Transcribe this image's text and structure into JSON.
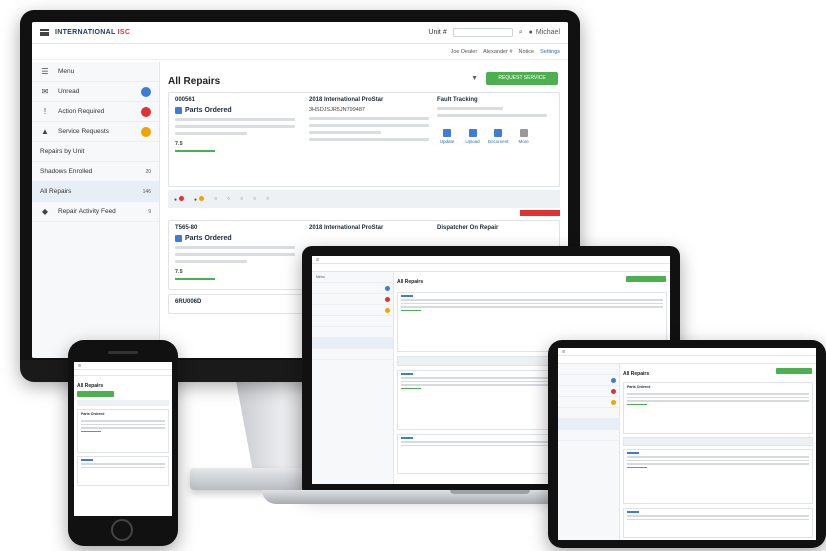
{
  "app": {
    "brand": "INTERNATIONAL",
    "brand_suffix": "ISC",
    "menu_label": "Menu",
    "search_dropdown": "Unit #",
    "user": "Michael"
  },
  "subbar": {
    "group_text": "Joe Dealer",
    "dealer_text": "Alexander #",
    "notice": "Notice",
    "settings": "Settings"
  },
  "sidebar": {
    "items": [
      {
        "label": "Unread",
        "icon": "inbox-icon",
        "badge_color": "#3b7dd8"
      },
      {
        "label": "Action Required",
        "icon": "alert-icon",
        "badge_color": "#e0332f"
      },
      {
        "label": "Service Requests",
        "icon": "wrench-icon",
        "badge_color": "#f0a400"
      },
      {
        "label": "Repairs by Unit",
        "icon": "",
        "badge_color": ""
      },
      {
        "label": "Shadows Enrolled",
        "icon": "",
        "count": "20"
      },
      {
        "label": "All Repairs",
        "icon": "",
        "count": "146"
      },
      {
        "label": "Repair Activity Feed",
        "icon": "feed-icon",
        "count": "9"
      }
    ]
  },
  "main": {
    "title": "All Repairs",
    "add_button": "REQUEST SERVICE",
    "cards": [
      {
        "unit": "000561",
        "status": "Parts Ordered",
        "vehicle_title": "2018 International ProStar",
        "vin": "3HSDJSJR5JN799487",
        "tracking_title": "Fault Tracking",
        "progress": "7.5",
        "actions": [
          "Update",
          "Upload",
          "Document",
          "More"
        ]
      },
      {
        "unit": "T565-80",
        "status": "Parts Ordered",
        "vehicle_title": "2018 International ProStar",
        "tracking_title": "Dispatcher On Repair",
        "progress": "7.5"
      },
      {
        "unit": "6RU006D",
        "status": ""
      }
    ]
  },
  "laptop": {
    "title": "All Repairs",
    "menu_label": "Menu"
  },
  "phone": {
    "title": "All Repairs",
    "status": "Parts Ordered"
  },
  "tablet": {
    "title": "All Repairs",
    "status": "Parts Ordered"
  },
  "colors": {
    "accent_green": "#4caf50",
    "accent_blue": "#3b7dd8",
    "alert_red": "#e0332f",
    "warning_orange": "#f0a400"
  }
}
